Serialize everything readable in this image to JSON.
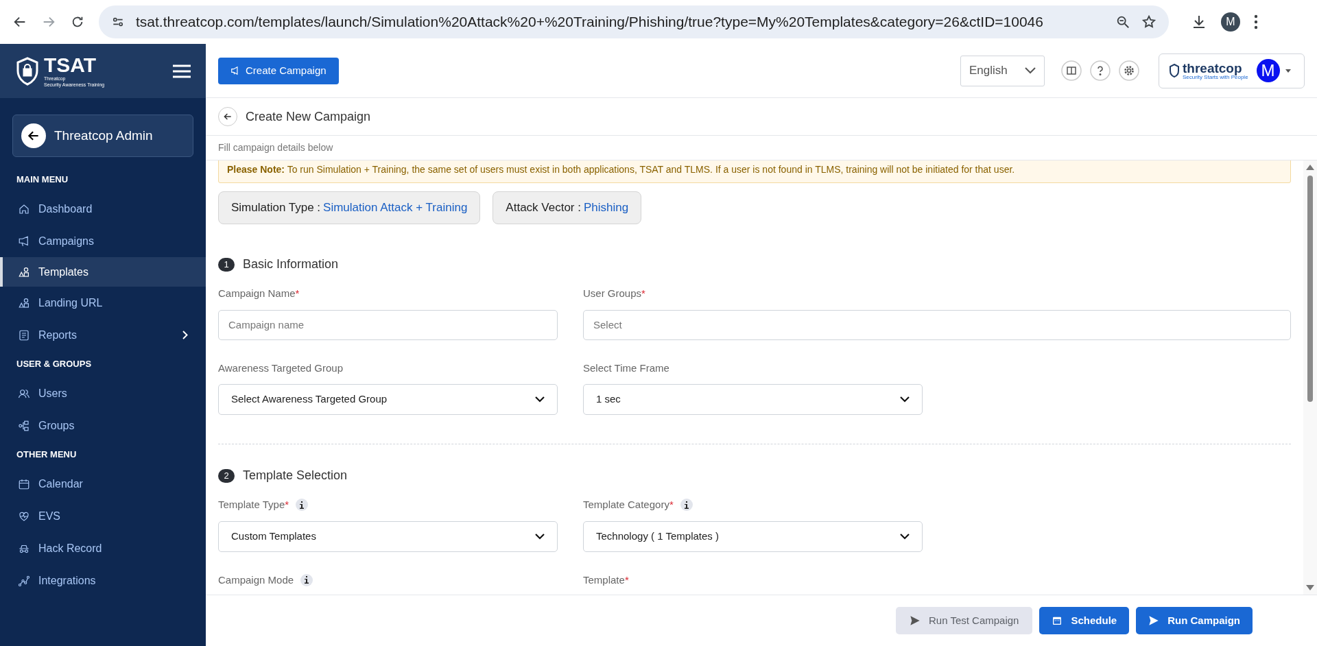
{
  "browser": {
    "url": "tsat.threatcop.com/templates/launch/Simulation%20Attack%20+%20Training/Phishing/true?type=My%20Templates&category=26&ctID=10046",
    "profile": "M"
  },
  "sidebar": {
    "brand": {
      "title": "TSAT",
      "line1": "Threatcop",
      "line2": "Security Awareness Training"
    },
    "account": "Threatcop Admin",
    "sections": [
      {
        "heading": "MAIN MENU",
        "items": [
          {
            "label": "Dashboard",
            "kind": "home",
            "selected": false,
            "expandable": false
          },
          {
            "label": "Campaigns",
            "kind": "megaphone",
            "selected": false,
            "expandable": false
          },
          {
            "label": "Templates",
            "kind": "shapes",
            "selected": true,
            "expandable": false
          },
          {
            "label": "Landing URL",
            "kind": "shapes",
            "selected": false,
            "expandable": false
          },
          {
            "label": "Reports",
            "kind": "report",
            "selected": false,
            "expandable": true
          }
        ]
      },
      {
        "heading": "USER & GROUPS",
        "items": [
          {
            "label": "Users",
            "kind": "users",
            "selected": false,
            "expandable": false
          },
          {
            "label": "Groups",
            "kind": "groups",
            "selected": false,
            "expandable": false
          }
        ]
      },
      {
        "heading": "OTHER MENU",
        "items": [
          {
            "label": "Calendar",
            "kind": "calendar",
            "selected": false,
            "expandable": false
          },
          {
            "label": "EVS",
            "kind": "heart",
            "selected": false,
            "expandable": false
          },
          {
            "label": "Hack Record",
            "kind": "spy",
            "selected": false,
            "expandable": false
          },
          {
            "label": "Integrations",
            "kind": "chart",
            "selected": false,
            "expandable": false
          }
        ]
      }
    ]
  },
  "topbar": {
    "create_button": "Create Campaign",
    "language": "English",
    "logo": "threatcop",
    "logo_tagline": "Security Starts with People",
    "avatar": "M"
  },
  "page": {
    "title": "Create New Campaign",
    "subtitle": "Fill campaign details below",
    "note": "**Please Note:** To run Simulation + Training, the same set of users must exist in both applications, TSAT and TLMS. If a user is not found in TLMS, training will not be initiated for that user.",
    "chips": [
      {
        "label": "Simulation Type :",
        "value": "Simulation Attack + Training"
      },
      {
        "label": "Attack Vector :",
        "value": "Phishing"
      }
    ],
    "sections": [
      {
        "number": "1",
        "title": "Basic Information",
        "fields": [
          {
            "label": "Campaign Name",
            "required_mark": "*",
            "info": false,
            "kind": "input",
            "placeholder": "Campaign name"
          },
          {
            "label": "User Groups",
            "required_mark": "*",
            "info": false,
            "kind": "input",
            "placeholder": "Select"
          },
          {
            "label": "Awareness Targeted Group",
            "info": false,
            "kind": "select",
            "value": "Select Awareness Targeted Group"
          },
          {
            "label": "Select Time Frame",
            "info": false,
            "kind": "select",
            "value": "1 sec"
          }
        ]
      },
      {
        "number": "2",
        "title": "Template Selection",
        "fields": [
          {
            "label": "Template Type",
            "required_mark": "*",
            "info": true,
            "kind": "select",
            "value": "Custom Templates"
          },
          {
            "label": "Template Category",
            "required_mark": "*",
            "info": true,
            "kind": "select",
            "value": "Technology ( 1 Templates )"
          },
          {
            "label": "Campaign Mode",
            "info": true,
            "kind": "label"
          },
          {
            "label": "Template",
            "required_mark": "*",
            "info": false,
            "kind": "label"
          }
        ]
      }
    ]
  },
  "actions": [
    {
      "label": "Run Test Campaign",
      "kind": "send",
      "disabled": true
    },
    {
      "label": "Schedule",
      "kind": "calendar",
      "disabled": false
    },
    {
      "label": "Run Campaign",
      "kind": "send",
      "disabled": false
    }
  ]
}
